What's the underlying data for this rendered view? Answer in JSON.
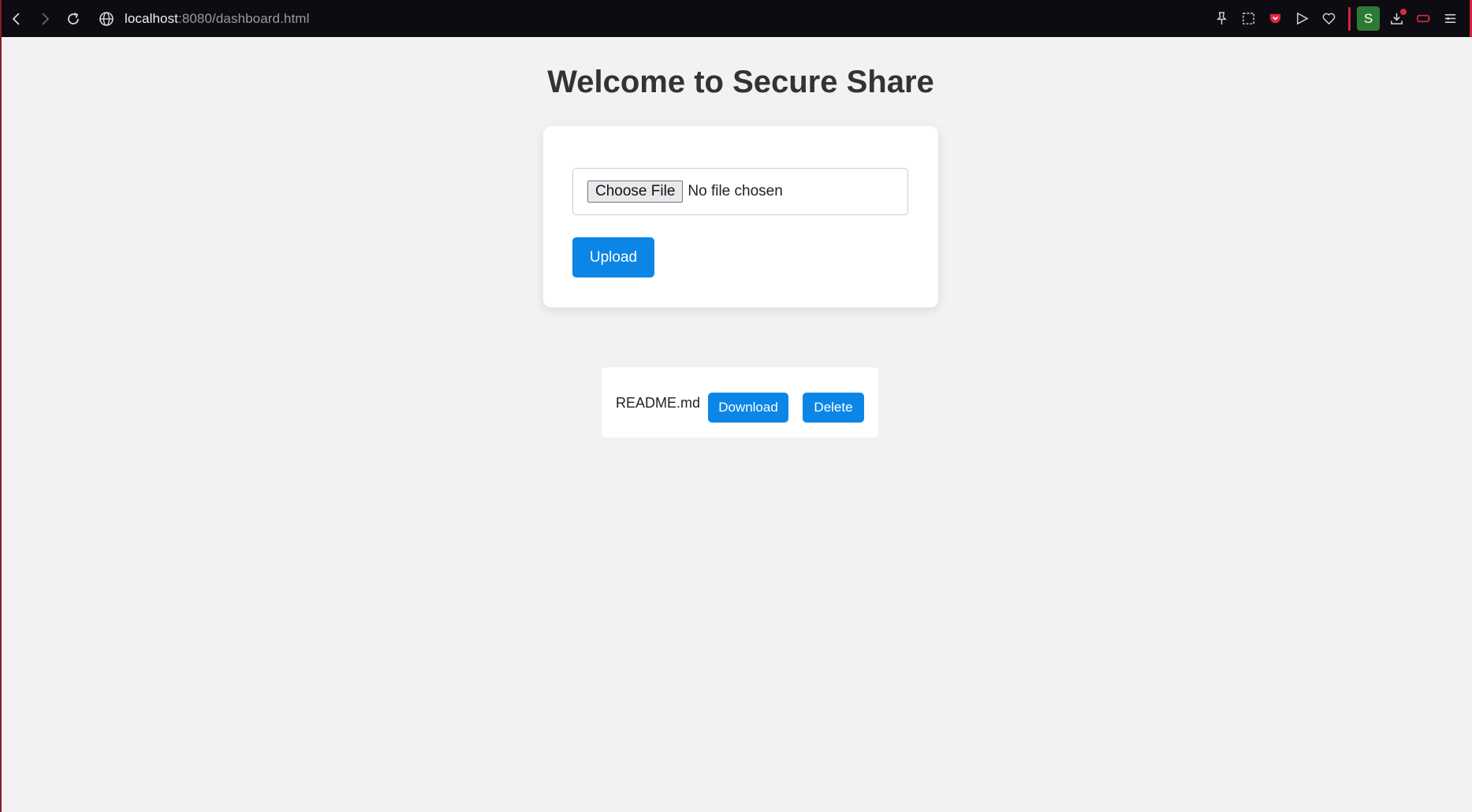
{
  "browser": {
    "url_host": "localhost",
    "url_path": ":8080/dashboard.html",
    "profile_initial": "S",
    "icons": [
      "back-icon",
      "forward-icon",
      "reload-icon",
      "site-info-icon",
      "pin-icon",
      "screenshot-icon",
      "pocket-icon",
      "send-icon",
      "heart-icon",
      "download-icon",
      "battery-icon",
      "menu-icon"
    ],
    "accent_color": "#d3243d"
  },
  "page": {
    "title": "Welcome to Secure Share"
  },
  "upload": {
    "choose_file_label": "Choose File",
    "no_file_text": "No file chosen",
    "upload_label": "Upload",
    "button_color": "#0b86e6"
  },
  "files": [
    {
      "name": "README.md",
      "download_label": "Download",
      "delete_label": "Delete"
    }
  ]
}
